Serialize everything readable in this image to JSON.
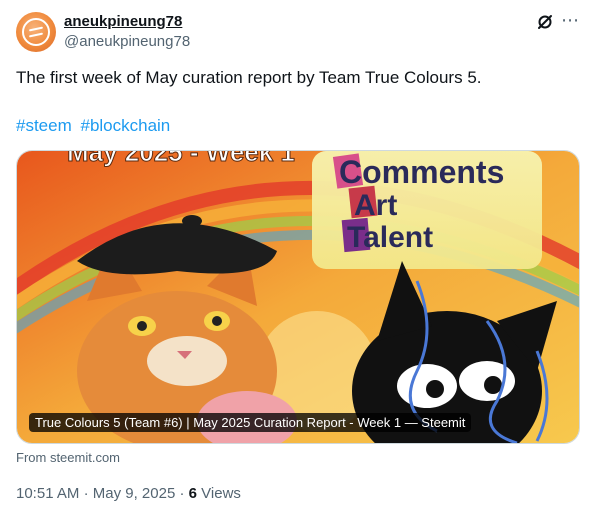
{
  "author": {
    "name": "aneukpineung78",
    "handle": "@aneukpineung78",
    "avatar_icon": "steem-logo-icon"
  },
  "icons": {
    "grok": "grok-icon",
    "more": "more-icon"
  },
  "tweet": {
    "text": "The first week of May curation report by Team True Colours 5.",
    "hashtags": [
      "#steem",
      "#blockchain"
    ]
  },
  "card": {
    "image_texts": {
      "banner": "May 2025 - Week 1",
      "word1": "Comments",
      "word2": "Art",
      "word3": "Talent"
    },
    "caption": "True Colours 5 (Team #6) | May 2025 Curation Report - Week 1 — Steemit",
    "source": "From steemit.com"
  },
  "meta": {
    "time": "10:51 AM",
    "separator": "·",
    "date": "May 9, 2025",
    "views_count": "6",
    "views_label": "Views"
  },
  "colors": {
    "link": "#1d9bf0",
    "muted": "#536471",
    "text": "#0f1419"
  }
}
